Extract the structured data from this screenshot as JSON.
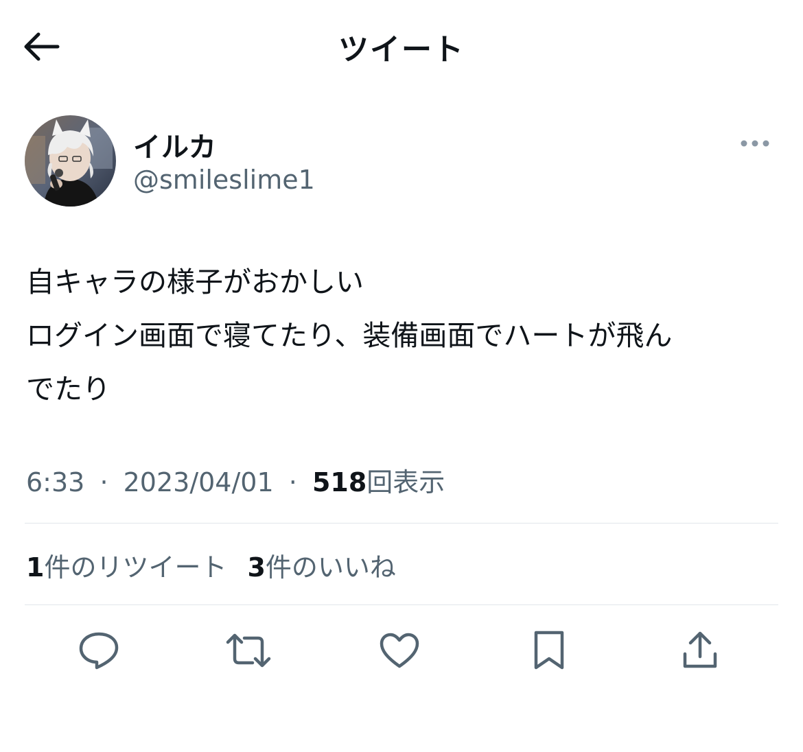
{
  "header": {
    "title": "ツイート",
    "back_icon": "arrow-left-icon"
  },
  "author": {
    "display_name": "イルカ",
    "handle": "@smileslime1",
    "more_icon": "more-horizontal-icon"
  },
  "tweet": {
    "lines": [
      "自キャラの様子がおかしい",
      "ログイン画面で寝てたり、装備画面でハートが飛ん",
      "でたり"
    ]
  },
  "meta": {
    "time": "6:33",
    "separator": "·",
    "date": "2023/04/01",
    "views_count": "518",
    "views_label": "回表示"
  },
  "stats": {
    "retweets_count": "1",
    "retweets_label": "件のリツイート",
    "likes_count": "3",
    "likes_label": "件のいいね"
  },
  "actions": [
    "reply-icon",
    "retweet-icon",
    "like-icon",
    "bookmark-icon",
    "share-icon"
  ],
  "colors": {
    "text": "#0f1419",
    "secondary": "#536471",
    "divider": "#e1e6ea",
    "icon": "#536471",
    "more_dots": "#8b98a5"
  }
}
